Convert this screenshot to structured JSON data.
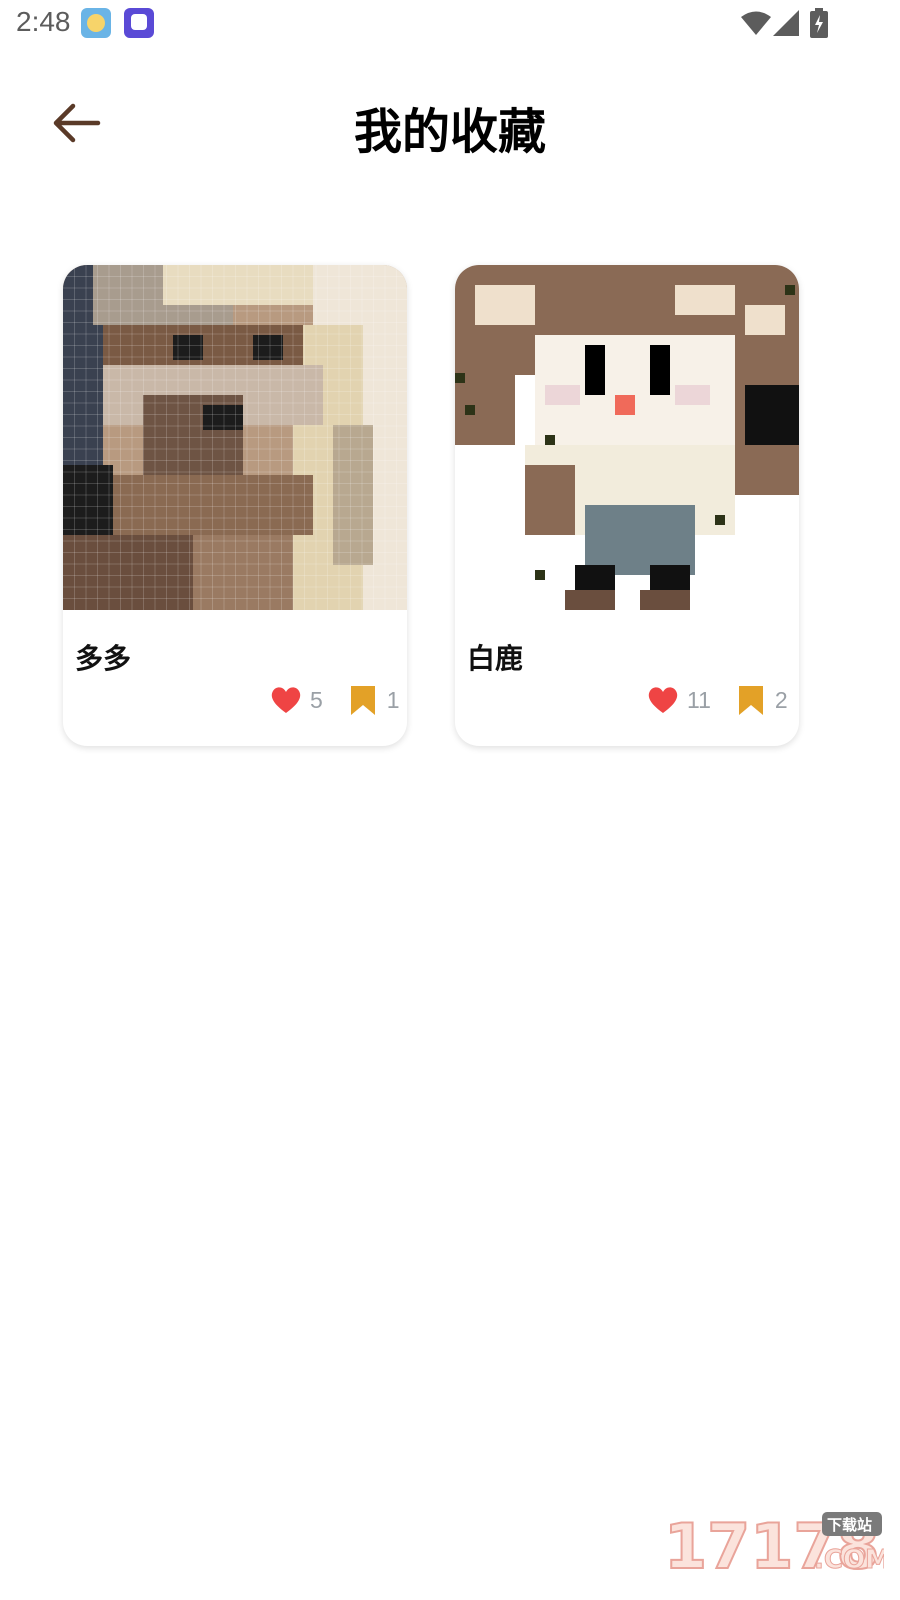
{
  "status_bar": {
    "time": "2:48",
    "icons": [
      "app-notification-icon",
      "app-notification-icon",
      "wifi-icon",
      "signal-icon",
      "battery-icon"
    ]
  },
  "header": {
    "back_icon": "arrow-left-icon",
    "title": "我的收藏"
  },
  "favorites": [
    {
      "title": "多多",
      "likes": "5",
      "collects": "1",
      "image": "pixel-art-portrait"
    },
    {
      "title": "白鹿",
      "likes": "11",
      "collects": "2",
      "image": "pixel-art-chibi-girl"
    }
  ],
  "colors": {
    "heart": "#ef4444",
    "bookmark": "#e3a127",
    "back_arrow": "#5a3a28",
    "title_text": "#000000",
    "count_text": "#9aa0a6"
  },
  "watermark": {
    "text": "17178",
    "sub_top": "下载站",
    "sub_bottom": ".COM"
  }
}
